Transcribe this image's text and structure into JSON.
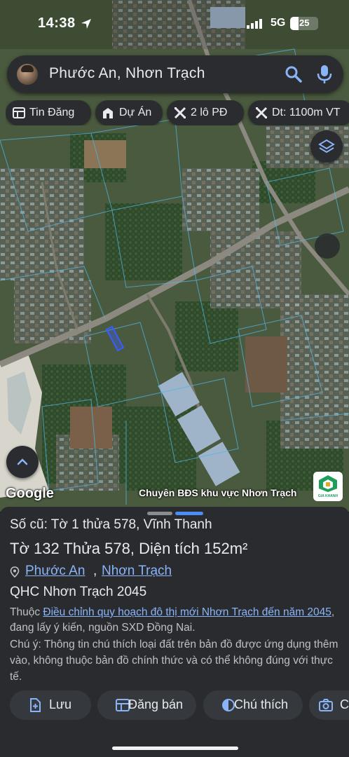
{
  "status_bar": {
    "time": "14:38",
    "network": "5G",
    "battery_percent": "25"
  },
  "search": {
    "query": "Phước An, Nhơn Trạch"
  },
  "chips": [
    {
      "label": "Tin Đăng",
      "icon": "list-icon"
    },
    {
      "label": "Dự Án",
      "icon": "buildings-icon"
    },
    {
      "label": "2 lô PĐ",
      "icon": "ruler-icon"
    },
    {
      "label": "Dt: 1100m VT",
      "icon": "ruler-icon"
    }
  ],
  "map": {
    "google_logo": "Google",
    "credit": "Chuyên BĐS khu vực Nhơn Trạch",
    "brand_logo_text": "GIA KHANH",
    "colors": {
      "satellite_green": "#3d5a34",
      "parcel_lines": "#4fb6e8",
      "highlight": "#3a5cff"
    }
  },
  "sheet": {
    "old_parcel": "Số cũ: Tờ 1 thửa 578, Vĩnh Thanh",
    "parcel_title": "Tờ 132 Thửa 578, Diện tích 152m²",
    "address_part1": "Phước An",
    "address_sep": ",",
    "address_part2": "Nhơn Trạch",
    "plan_name": "QHC Nhơn Trạch 2045",
    "plan_note_prefix": "Thuộc ",
    "plan_note_link": "Điều chỉnh quy hoạch đô thị mới Nhơn Trạch đến năm 2045",
    "plan_note_suffix": ", đang lấy ý kiến, nguồn SXD Đồng Nai.",
    "disclaimer": "Chú ý: Thông tin chú thích loại đất trên bản đồ được ứng dụng thêm vào, không thuộc bản đồ chính thức và có thể không đúng với thực tế.",
    "actions": [
      {
        "label": "Lưu",
        "icon": "save-icon"
      },
      {
        "label": "Đăng bán",
        "icon": "listing-icon"
      },
      {
        "label": "Chú thích",
        "icon": "contrast-icon"
      },
      {
        "label": "C",
        "icon": "camera-icon"
      }
    ]
  }
}
